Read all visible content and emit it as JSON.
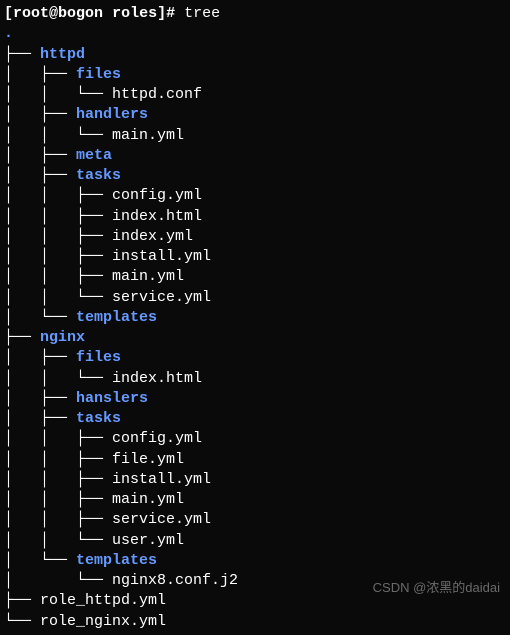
{
  "prompt": {
    "user": "root",
    "host": "bogon",
    "dir": "roles",
    "symbol": "#",
    "command": "tree"
  },
  "tree": {
    "root": ".",
    "nodes": {
      "httpd": "httpd",
      "httpd_files": "files",
      "httpd_files_conf": "httpd.conf",
      "httpd_handlers": "handlers",
      "httpd_handlers_main": "main.yml",
      "httpd_meta": "meta",
      "httpd_tasks": "tasks",
      "httpd_tasks_config": "config.yml",
      "httpd_tasks_indexhtml": "index.html",
      "httpd_tasks_indexyml": "index.yml",
      "httpd_tasks_install": "install.yml",
      "httpd_tasks_main": "main.yml",
      "httpd_tasks_service": "service.yml",
      "httpd_templates": "templates",
      "nginx": "nginx",
      "nginx_files": "files",
      "nginx_files_index": "index.html",
      "nginx_hanslers": "hanslers",
      "nginx_tasks": "tasks",
      "nginx_tasks_config": "config.yml",
      "nginx_tasks_file": "file.yml",
      "nginx_tasks_install": "install.yml",
      "nginx_tasks_main": "main.yml",
      "nginx_tasks_service": "service.yml",
      "nginx_tasks_user": "user.yml",
      "nginx_templates": "templates",
      "nginx_templates_conf": "nginx8.conf.j2",
      "role_httpd": "role_httpd.yml",
      "role_nginx": "role_nginx.yml"
    }
  },
  "watermark": "CSDN @浓黑的daidai"
}
